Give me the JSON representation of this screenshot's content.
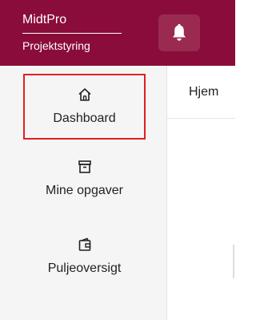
{
  "header": {
    "brand_name": "MidtPro",
    "brand_subtitle": "Projektstyring",
    "notifications_icon": "bell-icon",
    "colors": {
      "background": "#8a0c3a",
      "button": "#9a2a50"
    }
  },
  "sidebar": {
    "items": [
      {
        "label": "Dashboard",
        "icon": "home-icon",
        "active": true
      },
      {
        "label": "Mine opgaver",
        "icon": "archive-box-icon",
        "active": false
      },
      {
        "label": "Puljeoversigt",
        "icon": "wallet-icon",
        "active": false
      }
    ],
    "active_border_color": "#e0201f"
  },
  "main": {
    "breadcrumb": "Hjem"
  }
}
